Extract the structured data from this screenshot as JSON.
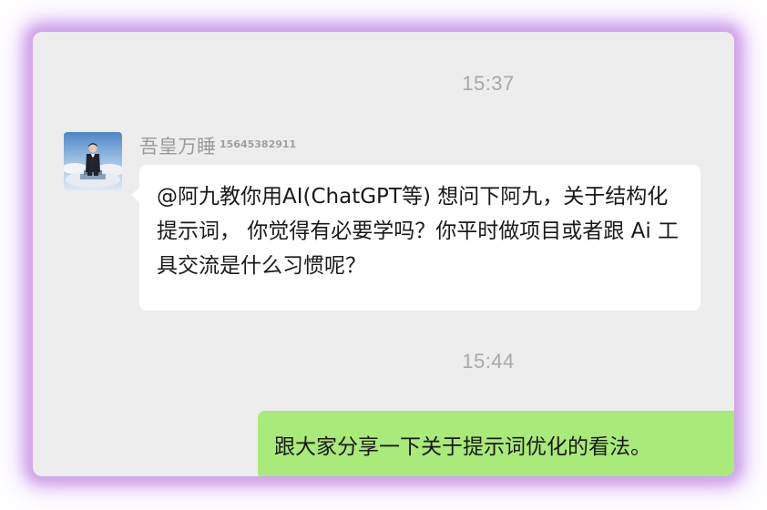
{
  "chat": {
    "timestamps": [
      "15:37",
      "15:44"
    ],
    "incoming": {
      "sender_name": "吾皇万睡",
      "sender_id": "15645382911",
      "avatar": "avatar-icon",
      "text": "@阿九教你用AI(ChatGPT等) 想问下阿九，关于结构化提示词， 你觉得有必要学吗？你平时做项目或者跟 Ai 工具交流是什么习惯呢？"
    },
    "outgoing": {
      "text": "跟大家分享一下关于提示词优化的看法。"
    }
  },
  "colors": {
    "window_bg": "#ededed",
    "incoming_bubble": "#ffffff",
    "outgoing_bubble": "#a9ea7a",
    "glow": "#b26ee0"
  }
}
